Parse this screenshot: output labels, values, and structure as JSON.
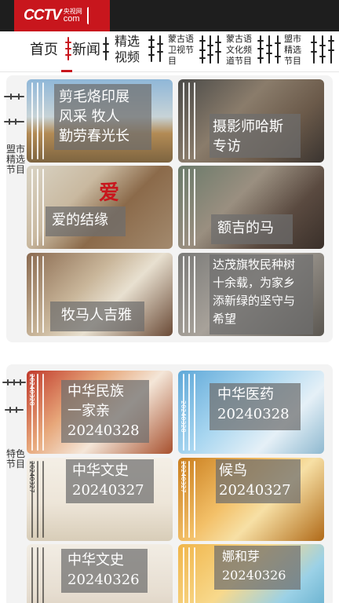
{
  "header": {
    "logo_text": "CCTV",
    "logo_cn": "央视网",
    "logo_com": "com"
  },
  "nav": {
    "items": [
      {
        "label": "首页",
        "active": false
      },
      {
        "label": "新闻",
        "active": true
      },
      {
        "label": "精选视频",
        "line1": "精选",
        "line2": "视频",
        "active": false
      },
      {
        "label": "蒙古语卫视节目",
        "line1": "蒙古语",
        "line2": "卫视节",
        "line3": "目",
        "active": false
      },
      {
        "label": "蒙古语文化频道节目",
        "line1": "蒙古语",
        "line2": "文化频",
        "line3": "道节目",
        "active": false
      },
      {
        "label": "盟市精选节目",
        "line1": "盟市",
        "line2": "精选",
        "line3": "节目",
        "active": false
      }
    ],
    "accent_color": "#c8161d"
  },
  "sections": [
    {
      "label": "盟市精选节目",
      "label_lines": [
        "盟市",
        "精选",
        "节目"
      ],
      "cards": [
        {
          "title": "剪毛烙印展风采 牧人勤劳春光长",
          "lines": [
            "剪毛烙印展",
            "风采 牧人",
            "勤劳春光长"
          ]
        },
        {
          "title": "摄影师哈斯专访",
          "lines": [
            "摄影师哈斯",
            "专访"
          ]
        },
        {
          "title": "爱的结缘",
          "lines": [
            "爱的结缘"
          ]
        },
        {
          "title": "额吉的马",
          "lines": [
            "额吉的马"
          ]
        },
        {
          "title": "牧马人吉雅",
          "lines": [
            "牧马人吉雅"
          ]
        },
        {
          "title": "达茂旗牧民种树十余载，为家乡添新绿的坚守与希望",
          "lines": [
            "达茂旗牧民种树",
            "十余载，为家乡",
            "添新绿的坚守与",
            "希望"
          ]
        }
      ]
    },
    {
      "label": "特色节目",
      "label_lines": [
        "特色",
        "节目"
      ],
      "cards": [
        {
          "title": "中华民族一家亲",
          "date": "20240328",
          "lines": [
            "中华民族",
            "一家亲",
            "20240328"
          ],
          "corner_date": "20240328"
        },
        {
          "title": "中华医药",
          "date": "20240328",
          "lines": [
            "中华医药",
            "20240328"
          ],
          "corner_date": "20240328"
        },
        {
          "title": "中华文史",
          "date": "20240327",
          "lines": [
            "中华文史",
            "20240327"
          ],
          "corner_date": "20240327"
        },
        {
          "title": "候鸟",
          "date": "20240327",
          "lines": [
            "候鸟",
            "20240327"
          ],
          "corner_date": "20240327"
        },
        {
          "title": "中华文史",
          "date": "20240326",
          "lines": [
            "中华文史",
            "20240326"
          ]
        },
        {
          "title": "娜和芽",
          "date": "20240326",
          "lines": [
            "娜和芽",
            "20240326"
          ]
        }
      ]
    }
  ]
}
